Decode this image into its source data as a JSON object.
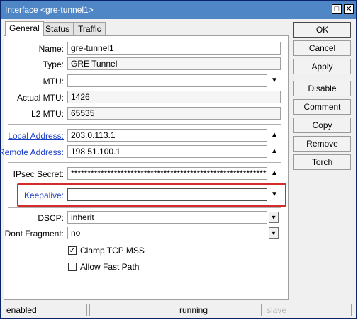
{
  "window": {
    "title": "Interface <gre-tunnel1>"
  },
  "tabs": [
    "General",
    "Status",
    "Traffic"
  ],
  "fields": {
    "name": {
      "label": "Name:",
      "value": "gre-tunnel1"
    },
    "type": {
      "label": "Type:",
      "value": "GRE Tunnel"
    },
    "mtu": {
      "label": "MTU:",
      "value": ""
    },
    "actual_mtu": {
      "label": "Actual MTU:",
      "value": "1426"
    },
    "l2_mtu": {
      "label": "L2 MTU:",
      "value": "65535"
    },
    "local_address": {
      "label": "Local Address:",
      "value": "203.0.113.1"
    },
    "remote_address": {
      "label": "Remote Address:",
      "value": "198.51.100.1"
    },
    "ipsec_secret": {
      "label": "IPsec Secret:",
      "value": "*************************************************************"
    },
    "keepalive": {
      "label": "Keepalive:",
      "value": ""
    },
    "dscp": {
      "label": "DSCP:",
      "value": "inherit"
    },
    "dont_fragment": {
      "label": "Dont Fragment:",
      "value": "no"
    }
  },
  "checkboxes": {
    "clamp_tcp_mss": {
      "label": "Clamp TCP MSS",
      "checked": true
    },
    "allow_fast_path": {
      "label": "Allow Fast Path",
      "checked": false
    }
  },
  "buttons": [
    "OK",
    "Cancel",
    "Apply",
    "Disable",
    "Comment",
    "Copy",
    "Remove",
    "Torch"
  ],
  "statusbar": [
    "enabled",
    "",
    "running",
    "slave"
  ],
  "icons": {
    "dropdown": "triangle-down-icon",
    "collapse": "triangle-up-icon",
    "window_restore": "restore-icon",
    "window_close": "close-icon"
  },
  "colors": {
    "titlebar": "#4f86c6",
    "label_link": "#1c3fc8",
    "highlight_box": "#d62b2b"
  }
}
